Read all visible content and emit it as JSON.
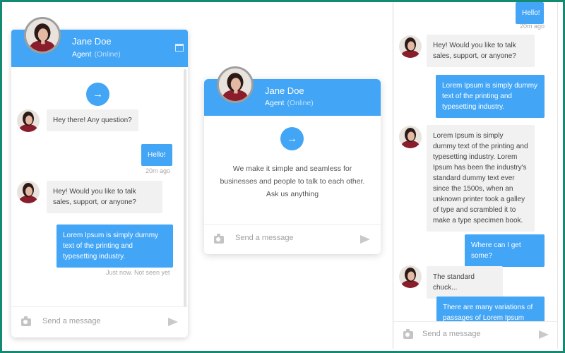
{
  "agent": {
    "name": "Jane Doe",
    "role": "Agent",
    "status": "(Online)"
  },
  "composer": {
    "placeholder": "Send a message"
  },
  "colors": {
    "accent": "#42a5f5",
    "frame": "#138a72",
    "incoming": "#f1f1f1"
  },
  "widget1": {
    "messages": [
      {
        "from": "agent",
        "text": "Hey there! Any question?"
      },
      {
        "from": "user",
        "text": "Hello!"
      },
      {
        "from": "agent",
        "text": "Hey! Would you like to talk sales, support, or anyone?"
      },
      {
        "from": "user",
        "text": "Lorem Ipsum is simply dummy text of the printing and typesetting industry."
      }
    ],
    "meta": [
      "20m ago",
      "Just now. Not seen yet"
    ]
  },
  "widget2": {
    "intro": "We make it simple and seamless for businesses and people to talk to each other. Ask us anything"
  },
  "widget3": {
    "messages": [
      {
        "from": "user",
        "text": "Hello!"
      },
      {
        "from": "agent",
        "text": "Hey! Would you like to talk sales, support, or anyone?"
      },
      {
        "from": "user",
        "text": "Lorem Ipsum is simply dummy text of the printing and typesetting industry."
      },
      {
        "from": "agent",
        "text": "Lorem Ipsum is simply dummy text of the printing and typesetting industry. Lorem Ipsum has been the industry's standard dummy text ever since the 1500s, when an unknown printer took a galley of type and scrambled it to make a type specimen book."
      },
      {
        "from": "user",
        "text": "Where can I get some?"
      },
      {
        "from": "agent",
        "text": "The standard chuck..."
      },
      {
        "from": "user",
        "text": "There are many variations of passages of Lorem Ipsum"
      }
    ],
    "meta": [
      "20m ago"
    ]
  },
  "icons": [
    "arrow-right-icon",
    "minimize-icon",
    "camera-icon",
    "send-icon",
    "agent-avatar"
  ]
}
